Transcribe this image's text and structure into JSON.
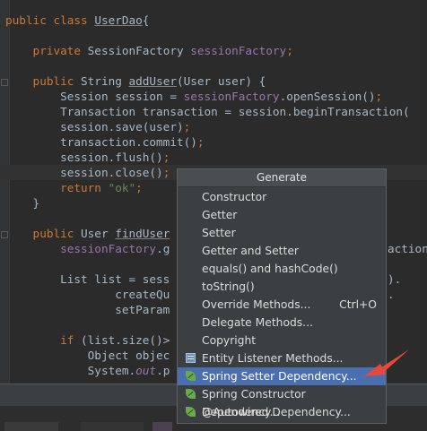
{
  "code_lines": [
    [
      {
        "t": "public class ",
        "c": "keyword"
      },
      {
        "t": "UserDao",
        "c": "default",
        "u": true
      },
      {
        "t": "{",
        "c": "default"
      }
    ],
    [],
    [
      {
        "t": "    private ",
        "c": "keyword"
      },
      {
        "t": "SessionFactory ",
        "c": "default"
      },
      {
        "t": "sessionFactory",
        "c": "field"
      },
      {
        "t": ";",
        "c": "keyword"
      }
    ],
    [],
    [
      {
        "t": "    public ",
        "c": "keyword"
      },
      {
        "t": "String ",
        "c": "default"
      },
      {
        "t": "addUser",
        "c": "default",
        "u": true
      },
      {
        "t": "(User user) {",
        "c": "default"
      }
    ],
    [
      {
        "t": "        Session session = ",
        "c": "default"
      },
      {
        "t": "sessionFactory",
        "c": "field"
      },
      {
        "t": ".openSession()",
        "c": "default"
      },
      {
        "t": ";",
        "c": "keyword"
      }
    ],
    [
      {
        "t": "        Transaction transaction = session.beginTransaction(",
        "c": "default"
      }
    ],
    [
      {
        "t": "        session.save(user)",
        "c": "default"
      },
      {
        "t": ";",
        "c": "keyword"
      }
    ],
    [
      {
        "t": "        transaction.commit()",
        "c": "default"
      },
      {
        "t": ";",
        "c": "keyword"
      }
    ],
    [
      {
        "t": "        session.flush()",
        "c": "default"
      },
      {
        "t": ";",
        "c": "keyword"
      }
    ],
    [
      {
        "t": "        session.close()",
        "c": "default"
      },
      {
        "t": ";",
        "c": "keyword"
      }
    ],
    [
      {
        "t": "        return ",
        "c": "keyword"
      },
      {
        "t": "\"ok\"",
        "c": "string"
      },
      {
        "t": ";",
        "c": "keyword"
      }
    ],
    [
      {
        "t": "    }",
        "c": "default"
      }
    ],
    [],
    [
      {
        "t": "    public ",
        "c": "keyword"
      },
      {
        "t": "User ",
        "c": "default"
      },
      {
        "t": "findUser",
        "c": "default",
        "u": true
      }
    ],
    [
      {
        "t": "        sessionFactory",
        "c": "field"
      },
      {
        "t": ".g",
        "c": "default"
      }
    ],
    [],
    [
      {
        "t": "        List list = sess",
        "c": "default"
      }
    ],
    [
      {
        "t": "                createQu",
        "c": "default"
      }
    ],
    [
      {
        "t": "                setParam",
        "c": "default"
      }
    ],
    [],
    [
      {
        "t": "        if ",
        "c": "keyword"
      },
      {
        "t": "(list.size()>",
        "c": "default"
      }
    ],
    [
      {
        "t": "            Object objec",
        "c": "default"
      }
    ],
    [
      {
        "t": "            System.",
        "c": "default"
      },
      {
        "t": "out",
        "c": "static"
      },
      {
        "t": ".p",
        "c": "default"
      }
    ],
    [
      {
        "t": "        ",
        "c": "default"
      }
    ]
  ],
  "code_right_fragments": [
    {
      "t": "action",
      "c": "default"
    },
    {
      "t": ").",
      "c": "default"
    },
    {
      "t": ".",
      "c": "default"
    }
  ],
  "popup": {
    "title": "Generate",
    "items": [
      {
        "label": "Constructor",
        "name": "menu-item-constructor"
      },
      {
        "label": "Getter",
        "name": "menu-item-getter"
      },
      {
        "label": "Setter",
        "name": "menu-item-setter"
      },
      {
        "label": "Getter and Setter",
        "name": "menu-item-getter-and-setter"
      },
      {
        "label": "equals() and hashCode()",
        "name": "menu-item-equals-hashcode"
      },
      {
        "label": "toString()",
        "name": "menu-item-tostring"
      },
      {
        "label": "Override Methods...",
        "name": "menu-item-override-methods",
        "shortcut": "Ctrl+O"
      },
      {
        "label": "Delegate Methods...",
        "name": "menu-item-delegate-methods"
      },
      {
        "label": "Copyright",
        "name": "menu-item-copyright"
      },
      {
        "label": "Entity Listener Methods...",
        "name": "menu-item-entity-listener-methods",
        "icon": "entity-icon"
      },
      {
        "label": "Spring Setter Dependency...",
        "name": "menu-item-spring-setter-dependency",
        "icon": "spring-leaf-icon",
        "selected": true
      },
      {
        "label": "Spring Constructor Dependency...",
        "name": "menu-item-spring-constructor-dependency",
        "icon": "spring-leaf-icon"
      },
      {
        "label": "@Autowired Dependency...",
        "name": "menu-item-autowired-dependency",
        "icon": "spring-leaf-icon"
      }
    ]
  },
  "colors": {
    "editor_bg": "#2b2b2b",
    "keyword": "#cc7832",
    "field": "#9876aa",
    "string": "#6a8759",
    "selection": "#4b6eaf",
    "popup_bg": "#3c3f41",
    "annotation_arrow": "#e8473b"
  }
}
